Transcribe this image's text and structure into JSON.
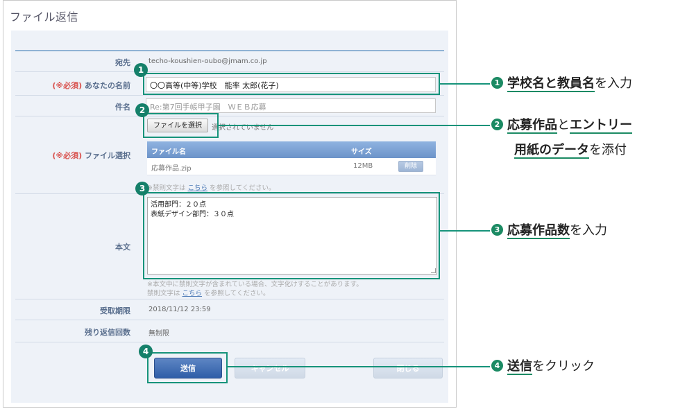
{
  "panel": {
    "title": "ファイル返信"
  },
  "form": {
    "to": {
      "label": "宛先",
      "value": "techo-koushien-oubo@jmam.co.jp"
    },
    "name": {
      "required_label": "(※必須)",
      "label": "あなたの名前",
      "value": "〇〇高等(中等)学校　能率 太郎(花子)"
    },
    "subject": {
      "label": "件名",
      "value": "Re:第7回手帳甲子園　ＷＥＢ応募"
    },
    "file": {
      "required_label": "(※必須)",
      "label": "ファイル選択",
      "choose_button": "ファイルを選択",
      "no_file_text": "選択されていません",
      "columns": [
        "ファイル名",
        "サイズ"
      ],
      "rows": [
        {
          "name": "応募作品.zip",
          "size": "12MB",
          "delete": "削除"
        }
      ],
      "note": {
        "prefix": "※禁則文字は ",
        "link": "こちら",
        "suffix": " を参照してください。"
      }
    },
    "body": {
      "label": "本文",
      "lines": [
        "活用部門：２０点",
        "表紙デザイン部門：３０点"
      ],
      "note1": "※本文中に禁則文字が含まれている場合、文字化けすることがあります。",
      "note2": {
        "prefix": "禁則文字は ",
        "link": "こちら",
        "suffix": " を参照してください。"
      }
    },
    "deadline": {
      "label": "受取期限",
      "value": "2018/11/12 23:59"
    },
    "remaining": {
      "label": "残り返信回数",
      "value": "無制限"
    }
  },
  "buttons": {
    "send": "送信",
    "cancel": "キャンセル",
    "close": "閉じる"
  },
  "markers": [
    "1",
    "2",
    "3",
    "4"
  ],
  "annotations": {
    "a1": {
      "num": "1",
      "em": "学校名と教員名",
      "rest": "を入力"
    },
    "a2": {
      "num": "2",
      "em1": "応募作品",
      "mid": "と",
      "em2": "エントリー",
      "em3": "用紙のデータ",
      "rest": "を添付"
    },
    "a3": {
      "num": "3",
      "em": "応募作品数",
      "rest": "を入力"
    },
    "a4": {
      "num": "4",
      "em": "送信",
      "rest": "をクリック"
    }
  },
  "colors": {
    "accent": "#16937a",
    "primary_button": "#2f5ea8",
    "required": "#d9534f",
    "header_blue": "#6c93c9"
  }
}
